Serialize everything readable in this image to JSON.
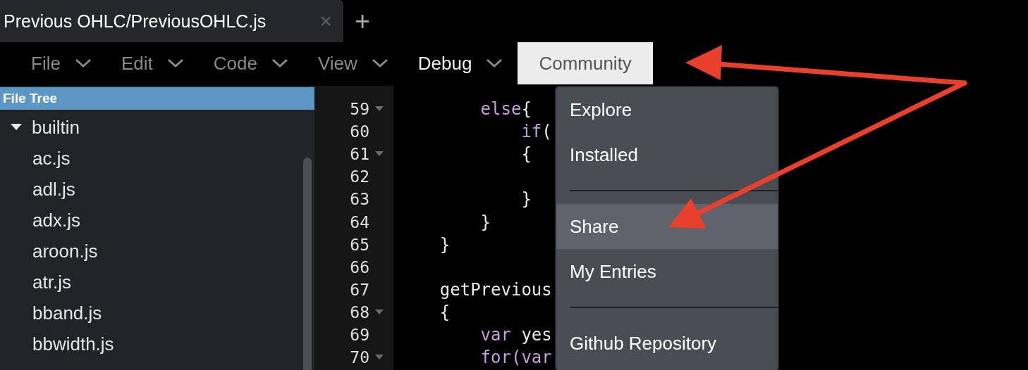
{
  "tab": {
    "title": "Previous OHLC/PreviousOHLC.js",
    "close": "×",
    "add": "+"
  },
  "menu_bar": [
    {
      "label": "File",
      "selected": false,
      "highlighted": false,
      "has_caret": true
    },
    {
      "label": "Edit",
      "selected": false,
      "highlighted": false,
      "has_caret": true
    },
    {
      "label": "Code",
      "selected": false,
      "highlighted": false,
      "has_caret": true
    },
    {
      "label": "View",
      "selected": false,
      "highlighted": false,
      "has_caret": true
    },
    {
      "label": "Debug",
      "selected": false,
      "highlighted": true,
      "has_caret": true
    },
    {
      "label": "Community",
      "selected": true,
      "highlighted": false,
      "has_caret": false
    }
  ],
  "dropdown": [
    {
      "kind": "item",
      "label": "Explore",
      "highlighted": false
    },
    {
      "kind": "item",
      "label": "Installed",
      "highlighted": false
    },
    {
      "kind": "divider"
    },
    {
      "kind": "item",
      "label": "Share",
      "highlighted": true
    },
    {
      "kind": "item",
      "label": "My Entries",
      "highlighted": false
    },
    {
      "kind": "divider"
    },
    {
      "kind": "item",
      "label": "Github Repository",
      "highlighted": false
    }
  ],
  "sidebar": {
    "title": "File Tree",
    "tree": [
      {
        "label": "builtin",
        "expanded": true,
        "children": [
          {
            "label": "ac.js"
          },
          {
            "label": "adl.js"
          },
          {
            "label": "adx.js"
          },
          {
            "label": "aroon.js"
          },
          {
            "label": "atr.js"
          },
          {
            "label": "bband.js"
          },
          {
            "label": "bbwidth.js"
          }
        ]
      }
    ]
  },
  "editor": {
    "lines": [
      {
        "number": "59",
        "foldable": true,
        "code": [
          {
            "text": "        else",
            "kind": "keyword"
          },
          {
            "text": "{",
            "kind": "plain"
          }
        ]
      },
      {
        "number": "60",
        "foldable": false,
        "code": [
          {
            "text": "            if",
            "kind": "keyword"
          },
          {
            "text": "(",
            "kind": "plain"
          }
        ]
      },
      {
        "number": "61",
        "foldable": true,
        "code": [
          {
            "text": "            {",
            "kind": "plain"
          }
        ]
      },
      {
        "number": "62",
        "foldable": false
      },
      {
        "number": "63",
        "foldable": false,
        "code": [
          {
            "text": "            }",
            "kind": "plain"
          }
        ]
      },
      {
        "number": "64",
        "foldable": false,
        "code": [
          {
            "text": "        }",
            "kind": "plain"
          }
        ]
      },
      {
        "number": "65",
        "foldable": false,
        "code": [
          {
            "text": "    }",
            "kind": "plain"
          }
        ]
      },
      {
        "number": "66",
        "foldable": false
      },
      {
        "number": "67",
        "foldable": false,
        "code": [
          {
            "text": "    getPrevious",
            "kind": "plain"
          }
        ]
      },
      {
        "number": "68",
        "foldable": true,
        "code": [
          {
            "text": "    {",
            "kind": "plain"
          }
        ]
      },
      {
        "number": "69",
        "foldable": false,
        "code": [
          {
            "text": "        var",
            "kind": "keyword"
          },
          {
            "text": " yes",
            "kind": "plain"
          }
        ]
      },
      {
        "number": "70",
        "foldable": true,
        "code": [
          {
            "text": "        for(var",
            "kind": "keyword"
          }
        ]
      }
    ]
  }
}
